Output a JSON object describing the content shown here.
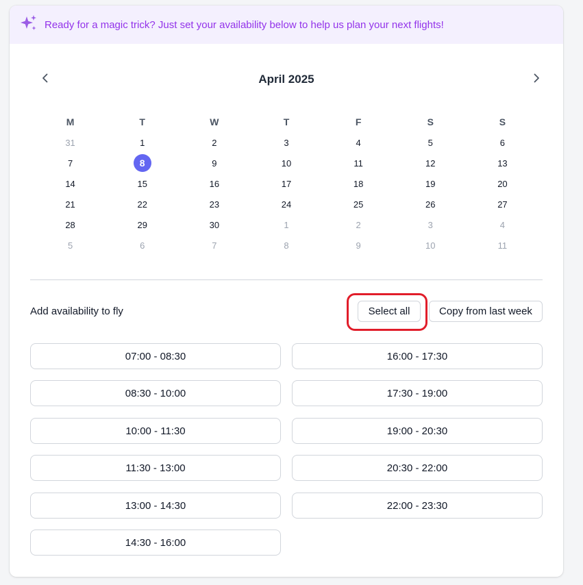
{
  "banner": {
    "text": "Ready for a magic trick? Just set your availability below to help us plan your next flights!",
    "icon": "sparkles-icon",
    "color": "#9333ea",
    "background": "#f4f0fe"
  },
  "calendar": {
    "month_title": "April 2025",
    "weekdays": [
      "M",
      "T",
      "W",
      "T",
      "F",
      "S",
      "S"
    ],
    "selected_day": "8",
    "accent": "#6366f1",
    "weeks": [
      [
        {
          "d": "31",
          "m": true
        },
        {
          "d": "1"
        },
        {
          "d": "2"
        },
        {
          "d": "3"
        },
        {
          "d": "4"
        },
        {
          "d": "5"
        },
        {
          "d": "6"
        }
      ],
      [
        {
          "d": "7"
        },
        {
          "d": "8"
        },
        {
          "d": "9"
        },
        {
          "d": "10"
        },
        {
          "d": "11"
        },
        {
          "d": "12"
        },
        {
          "d": "13"
        }
      ],
      [
        {
          "d": "14"
        },
        {
          "d": "15"
        },
        {
          "d": "16"
        },
        {
          "d": "17"
        },
        {
          "d": "18"
        },
        {
          "d": "19"
        },
        {
          "d": "20"
        }
      ],
      [
        {
          "d": "21"
        },
        {
          "d": "22"
        },
        {
          "d": "23"
        },
        {
          "d": "24"
        },
        {
          "d": "25"
        },
        {
          "d": "26"
        },
        {
          "d": "27"
        }
      ],
      [
        {
          "d": "28"
        },
        {
          "d": "29"
        },
        {
          "d": "30"
        },
        {
          "d": "1",
          "m": true
        },
        {
          "d": "2",
          "m": true
        },
        {
          "d": "3",
          "m": true
        },
        {
          "d": "4",
          "m": true
        }
      ],
      [
        {
          "d": "5",
          "m": true
        },
        {
          "d": "6",
          "m": true
        },
        {
          "d": "7",
          "m": true
        },
        {
          "d": "8",
          "m": true
        },
        {
          "d": "9",
          "m": true
        },
        {
          "d": "10",
          "m": true
        },
        {
          "d": "11",
          "m": true
        }
      ]
    ]
  },
  "availability": {
    "label": "Add availability to fly",
    "select_all_label": "Select all",
    "copy_label": "Copy from last week",
    "slots_left": [
      "07:00 - 08:30",
      "08:30 - 10:00",
      "10:00 - 11:30",
      "11:30 - 13:00",
      "13:00 - 14:30",
      "14:30 - 16:00"
    ],
    "slots_right": [
      "16:00 - 17:30",
      "17:30 - 19:00",
      "19:00 - 20:30",
      "20:30 - 22:00",
      "22:00 - 23:30"
    ]
  },
  "annotation": {
    "highlight_color": "#e11d2a"
  }
}
